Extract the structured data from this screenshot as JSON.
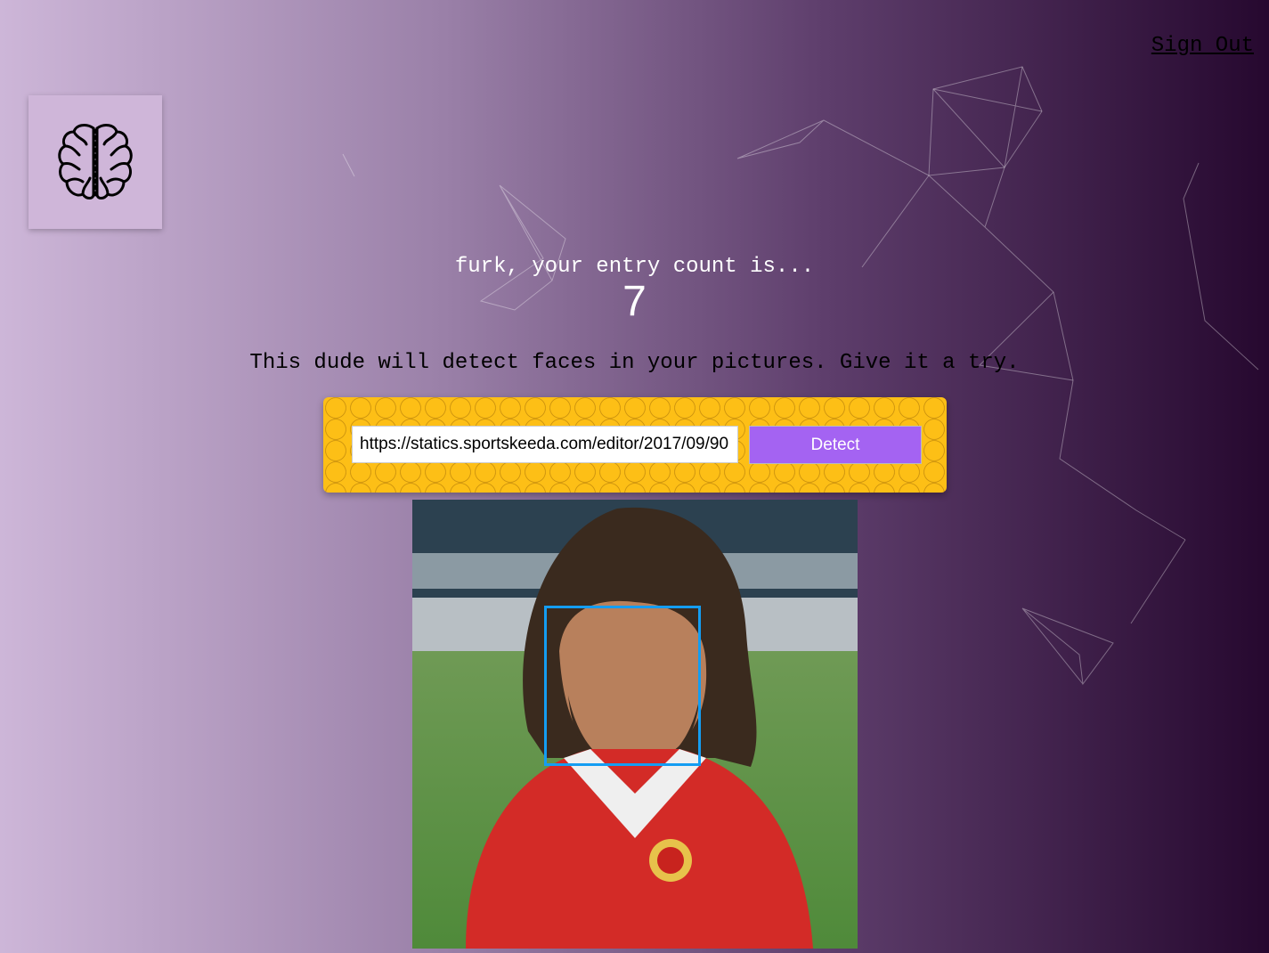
{
  "nav": {
    "signout_label": "Sign Out"
  },
  "logo": {
    "icon": "brain-icon"
  },
  "rank": {
    "label": "furk, your entry count is...",
    "count": "7"
  },
  "tagline": "This dude will detect faces in your pictures. Give it a try.",
  "form": {
    "url_value": "https://statics.sportskeeda.com/editor/2017/09/90",
    "detect_label": "Detect"
  },
  "colors": {
    "form_bg": "#fdbf16",
    "button_bg": "#a463f2",
    "face_box": "#149df2",
    "bg_light": "#cdb6d8",
    "bg_dark": "#26082f"
  }
}
